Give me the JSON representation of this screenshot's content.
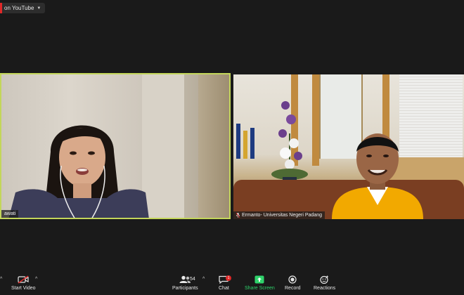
{
  "live": {
    "label": "on YouTube"
  },
  "participants_tiles": [
    {
      "name": "awati"
    },
    {
      "name": "Ermanto- Universitas Negeri Padang"
    }
  ],
  "toolbar": {
    "start_video_label": "Start Video",
    "participants_label": "Participants",
    "participants_count": "54",
    "chat_label": "Chat",
    "chat_badge": "1",
    "share_screen_label": "Share Screen",
    "record_label": "Record",
    "reactions_label": "Reactions"
  },
  "colors": {
    "active_speaker_border": "#c3d65a",
    "share_green": "#2fd36b",
    "live_red": "#e02828",
    "background": "#1a1a1a"
  }
}
